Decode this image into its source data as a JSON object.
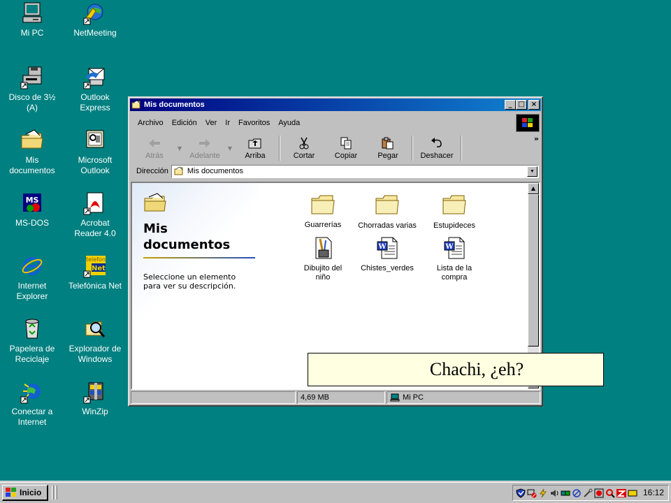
{
  "desktop": {
    "icons": [
      {
        "label": "Mi PC"
      },
      {
        "label": "NetMeeting"
      },
      {
        "label": "Disco de 3½\n(A)"
      },
      {
        "label": "Outlook\nExpress"
      },
      {
        "label": "Mis\ndocumentos"
      },
      {
        "label": "Microsoft\nOutlook"
      },
      {
        "label": "MS-DOS"
      },
      {
        "label": "Acrobat\nReader 4.0"
      },
      {
        "label": "Internet\nExplorer"
      },
      {
        "label": "Telefónica Net"
      },
      {
        "label": "Papelera de\nReciclaje"
      },
      {
        "label": "Explorador de\nWindows"
      },
      {
        "label": "Conectar a\nInternet"
      },
      {
        "label": "WinZip"
      }
    ],
    "logo_texts": {
      "msdos": "MS",
      "telefonica_top": "telefon",
      "telefonica_net": "Net"
    }
  },
  "window": {
    "title": "Mis documentos",
    "controls": {
      "minimize": "_",
      "maximize": "□",
      "close": "×"
    },
    "menu": [
      {
        "label": "Archivo"
      },
      {
        "label": "Edición"
      },
      {
        "label": "Ver"
      },
      {
        "label": "Ir"
      },
      {
        "label": "Favoritos"
      },
      {
        "label": "Ayuda"
      }
    ],
    "toolbar": {
      "back": "Atrás",
      "forward": "Adelante",
      "up": "Arriba",
      "cut": "Cortar",
      "copy": "Copiar",
      "paste": "Pegar",
      "undo": "Deshacer",
      "more": "»"
    },
    "address": {
      "label": "Dirección",
      "value": "Mis documentos"
    },
    "left_panel": {
      "title": "Mis\ndocumentos",
      "description": "Seleccione un elemento\npara ver su descripción."
    },
    "items": [
      {
        "label": "Guarrerías",
        "type": "folder"
      },
      {
        "label": "Chorradas varias",
        "type": "folder"
      },
      {
        "label": "Estupideces",
        "type": "folder"
      },
      {
        "label": "Dibujito del\nniño",
        "type": "paint"
      },
      {
        "label": "Chistes_verdes",
        "type": "word"
      },
      {
        "label": "Lista de la\ncompra",
        "type": "word"
      }
    ],
    "word_glyph": "W",
    "status": {
      "size": "4,69 MB",
      "location": "Mi PC"
    }
  },
  "tooltip": {
    "text": "Chachi, ¿eh?"
  },
  "taskbar": {
    "start_label": "Inicio",
    "clock": "16:12"
  },
  "colors": {
    "desktop": "#008080",
    "title_start": "#000080",
    "title_end": "#1084d0",
    "folder": "#f8e7a0",
    "tooltip_bg": "#ffffe1"
  }
}
